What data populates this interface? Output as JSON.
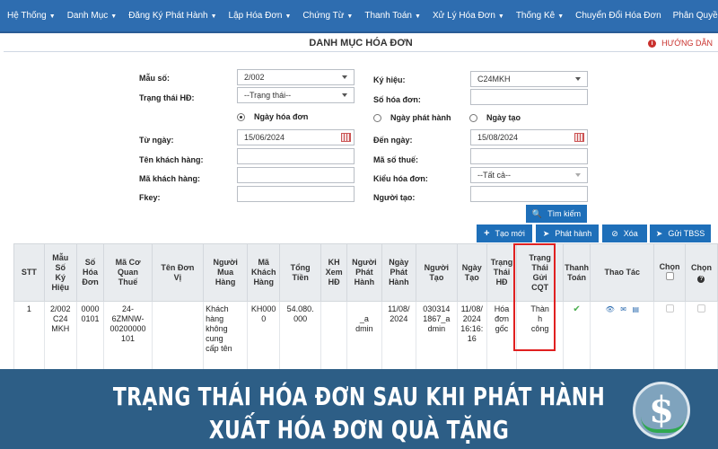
{
  "nav": {
    "items": [
      {
        "label": "Hệ Thống",
        "dropdown": true
      },
      {
        "label": "Danh Mục",
        "dropdown": true
      },
      {
        "label": "Đăng Ký Phát Hành",
        "dropdown": true
      },
      {
        "label": "Lập Hóa Đơn",
        "dropdown": true
      },
      {
        "label": "Chứng Từ",
        "dropdown": true
      },
      {
        "label": "Thanh Toán",
        "dropdown": true
      },
      {
        "label": "Xử Lý Hóa Đơn",
        "dropdown": true
      },
      {
        "label": "Thống Kê",
        "dropdown": true
      },
      {
        "label": "Chuyển Đổi Hóa Đơn",
        "dropdown": false
      },
      {
        "label": "Phân Quyền",
        "dropdown": true
      }
    ]
  },
  "page": {
    "title": "DANH MỤC HÓA ĐƠN",
    "help_label": "HƯỚNG DẪN"
  },
  "form": {
    "mau_so": {
      "label": "Mẫu số:",
      "value": "2/002"
    },
    "ky_hieu": {
      "label": "Ký hiệu:",
      "value": "C24MKH"
    },
    "trang_thai": {
      "label": "Trạng thái HĐ:",
      "value": "--Trạng thái--"
    },
    "so_hoa_don": {
      "label": "Số hóa đơn:",
      "value": ""
    },
    "radios": {
      "ngay_hoa_don": "Ngày hóa đơn",
      "ngay_phat_hanh": "Ngày phát hành",
      "ngay_tao": "Ngày tạo",
      "selected": "ngay_hoa_don"
    },
    "tu_ngay": {
      "label": "Từ ngày:",
      "value": "15/06/2024"
    },
    "den_ngay": {
      "label": "Đến ngày:",
      "value": "15/08/2024"
    },
    "ten_khach_hang": {
      "label": "Tên khách hàng:",
      "value": ""
    },
    "ma_so_thue": {
      "label": "Mã số thuế:",
      "value": ""
    },
    "ma_khach_hang": {
      "label": "Mã khách hàng:",
      "value": ""
    },
    "kieu_hoa_don": {
      "label": "Kiểu hóa đơn:",
      "value": "--Tất cả--"
    },
    "fkey": {
      "label": "Fkey:",
      "value": ""
    },
    "nguoi_tao": {
      "label": "Người tạo:",
      "value": ""
    }
  },
  "buttons": {
    "tim_kiem": "Tìm kiếm",
    "tao_moi": "Tạo mới",
    "phat_hanh": "Phát hành",
    "xoa": "Xóa",
    "gui_tbss": "Gửi TBSS"
  },
  "table": {
    "headers": {
      "stt": [
        "STT"
      ],
      "mau_so_ky_hieu": [
        "Mẫu",
        "Số",
        "Ký",
        "Hiệu"
      ],
      "so_hoa_don": [
        "Số",
        "Hóa",
        "Đơn"
      ],
      "ma_co_quan_thue": [
        "Mã Cơ",
        "Quan",
        "Thuế"
      ],
      "ten_don_vi": [
        "Tên Đơn",
        "Vị"
      ],
      "nguoi_mua_hang": [
        "Người",
        "Mua",
        "Hàng"
      ],
      "ma_khach_hang": [
        "Mã",
        "Khách",
        "Hàng"
      ],
      "tong_tien": [
        "Tổng",
        "Tiền"
      ],
      "kh_xem_hd": [
        "KH",
        "Xem",
        "HĐ"
      ],
      "nguoi_phat_hanh": [
        "Người",
        "Phát",
        "Hành"
      ],
      "ngay_phat_hanh": [
        "Ngày",
        "Phát",
        "Hành"
      ],
      "nguoi_tao": [
        "Người",
        "Tạo"
      ],
      "ngay_tao": [
        "Ngày",
        "Tạo"
      ],
      "trang_thai_hd": [
        "Trạng",
        "Thái",
        "HĐ"
      ],
      "trang_thai_gui_cqt": [
        "Trạng",
        "Thái",
        "Gửi",
        "CQT"
      ],
      "thanh_toan": [
        "Thanh",
        "Toán"
      ],
      "thao_tac": [
        "Thao Tác"
      ],
      "chon1": [
        "Chọn"
      ],
      "chon2": [
        "Chọn"
      ]
    },
    "rows": [
      {
        "stt": [
          "1"
        ],
        "mau_so_ky_hieu": [
          "2/002",
          "C24",
          "MKH"
        ],
        "so_hoa_don": [
          "0000",
          "0101"
        ],
        "ma_co_quan_thue": [
          "24-",
          "6ZMNW-",
          "00200000",
          "101"
        ],
        "ten_don_vi": [],
        "nguoi_mua_hang": [
          "Khách",
          "hàng",
          "không",
          "cung",
          "cấp tên"
        ],
        "ma_khach_hang": [
          "KH000",
          "0"
        ],
        "tong_tien": [
          "54.080.",
          "000"
        ],
        "kh_xem_hd": [],
        "nguoi_phat_hanh": [
          "_a",
          "dmin"
        ],
        "ngay_phat_hanh": [
          "11/08/",
          "2024"
        ],
        "nguoi_tao": [
          "030314",
          "1867_a",
          "dmin"
        ],
        "ngay_tao": [
          "11/08/",
          "2024",
          "16:16:",
          "16"
        ],
        "trang_thai_hd": [
          "Hóa",
          "đơn",
          "gốc"
        ],
        "trang_thai_gui_cqt": [
          "Thàn",
          "h",
          "công"
        ]
      }
    ]
  },
  "banner": {
    "line1": "TRẠNG THÁI HÓA ĐƠN SAU KHI PHÁT HÀNH",
    "line2": "XUẤT HÓA ĐƠN QUÀ TẶNG"
  },
  "colors": {
    "nav_bg": "#2e6db0",
    "button_bg": "#1e6fb9",
    "highlight": "#e02020",
    "banner_bg": "#2d5e86",
    "check": "#4caf50",
    "help_red": "#c9302c"
  }
}
